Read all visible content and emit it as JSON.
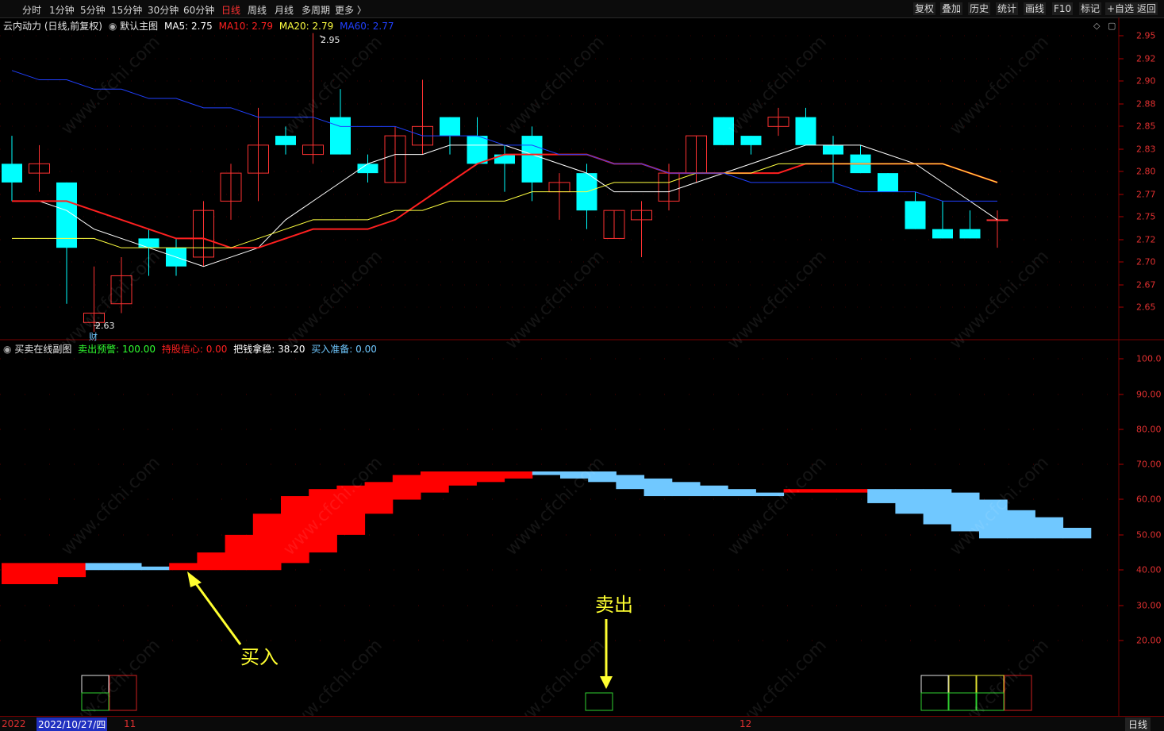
{
  "toolbar": {
    "periods": [
      "分时",
      "1分钟",
      "5分钟",
      "15分钟",
      "30分钟",
      "60分钟",
      "日线",
      "周线",
      "月线",
      "多周期",
      "更多 〉"
    ],
    "active_period": "日线",
    "right_buttons": [
      "复权",
      "叠加",
      "历史",
      "统计",
      "画线",
      "F10",
      "标记",
      "+自选",
      "返回"
    ]
  },
  "main_chart": {
    "stock_title": "云内动力 (日线,前复权)",
    "template": "默认主图",
    "ma": [
      {
        "label": "MA5: 2.75",
        "color": "#ffffff"
      },
      {
        "label": "MA10: 2.79",
        "color": "#ff2020"
      },
      {
        "label": "MA20: 2.79",
        "color": "#ffff40"
      },
      {
        "label": "MA60: 2.77",
        "color": "#2040ff"
      }
    ],
    "high_marker": "2.95",
    "low_marker": "2.63",
    "cai_marker": "财",
    "y_axis": [
      "2.95",
      "2.92",
      "2.90",
      "2.88",
      "2.85",
      "2.83",
      "2.80",
      "2.77",
      "2.75",
      "2.72",
      "2.70",
      "2.67",
      "2.65"
    ]
  },
  "sub_chart": {
    "title": "买卖在线副图",
    "labels": [
      {
        "text": "卖出预警: 100.00",
        "color": "#30ff30"
      },
      {
        "text": "持股信心: 0.00",
        "color": "#ff2020"
      },
      {
        "text": "把钱拿稳: 38.20",
        "color": "#ffffff"
      },
      {
        "text": "买入准备: 0.00",
        "color": "#70c8ff"
      }
    ],
    "y_axis": [
      "100.0",
      "90.00",
      "80.00",
      "70.00",
      "60.00",
      "50.00",
      "40.00",
      "30.00",
      "20.00"
    ],
    "buy_annotation": "买入",
    "sell_annotation": "卖出"
  },
  "bottom_bar": {
    "year": "2022",
    "current_date": "2022/10/27/四",
    "month_11": "11",
    "month_12": "12",
    "period": "日线"
  },
  "watermark": "www.cfchi.com",
  "chart_data": {
    "type": "candlestick",
    "ylim": [
      2.63,
      2.96
    ],
    "candles": [
      {
        "o": 2.81,
        "h": 2.84,
        "l": 2.77,
        "c": 2.79
      },
      {
        "o": 2.8,
        "h": 2.83,
        "l": 2.78,
        "c": 2.81
      },
      {
        "o": 2.79,
        "h": 2.79,
        "l": 2.66,
        "c": 2.72
      },
      {
        "o": 2.64,
        "h": 2.7,
        "l": 2.63,
        "c": 2.65
      },
      {
        "o": 2.66,
        "h": 2.71,
        "l": 2.65,
        "c": 2.69
      },
      {
        "o": 2.73,
        "h": 2.74,
        "l": 2.69,
        "c": 2.72
      },
      {
        "o": 2.72,
        "h": 2.73,
        "l": 2.69,
        "c": 2.7
      },
      {
        "o": 2.71,
        "h": 2.77,
        "l": 2.7,
        "c": 2.76
      },
      {
        "o": 2.77,
        "h": 2.81,
        "l": 2.75,
        "c": 2.8
      },
      {
        "o": 2.8,
        "h": 2.87,
        "l": 2.77,
        "c": 2.83
      },
      {
        "o": 2.84,
        "h": 2.85,
        "l": 2.82,
        "c": 2.83
      },
      {
        "o": 2.82,
        "h": 2.95,
        "l": 2.81,
        "c": 2.83
      },
      {
        "o": 2.86,
        "h": 2.89,
        "l": 2.82,
        "c": 2.82
      },
      {
        "o": 2.81,
        "h": 2.82,
        "l": 2.79,
        "c": 2.8
      },
      {
        "o": 2.79,
        "h": 2.85,
        "l": 2.79,
        "c": 2.84
      },
      {
        "o": 2.83,
        "h": 2.9,
        "l": 2.82,
        "c": 2.85
      },
      {
        "o": 2.86,
        "h": 2.86,
        "l": 2.82,
        "c": 2.84
      },
      {
        "o": 2.84,
        "h": 2.86,
        "l": 2.81,
        "c": 2.81
      },
      {
        "o": 2.82,
        "h": 2.83,
        "l": 2.78,
        "c": 2.81
      },
      {
        "o": 2.84,
        "h": 2.85,
        "l": 2.77,
        "c": 2.79
      },
      {
        "o": 2.78,
        "h": 2.8,
        "l": 2.75,
        "c": 2.79
      },
      {
        "o": 2.8,
        "h": 2.81,
        "l": 2.74,
        "c": 2.76
      },
      {
        "o": 2.73,
        "h": 2.76,
        "l": 2.73,
        "c": 2.76
      },
      {
        "o": 2.75,
        "h": 2.77,
        "l": 2.71,
        "c": 2.76
      },
      {
        "o": 2.77,
        "h": 2.81,
        "l": 2.76,
        "c": 2.8
      },
      {
        "o": 2.8,
        "h": 2.84,
        "l": 2.79,
        "c": 2.84
      },
      {
        "o": 2.86,
        "h": 2.86,
        "l": 2.83,
        "c": 2.83
      },
      {
        "o": 2.84,
        "h": 2.84,
        "l": 2.82,
        "c": 2.83
      },
      {
        "o": 2.85,
        "h": 2.87,
        "l": 2.84,
        "c": 2.86
      },
      {
        "o": 2.86,
        "h": 2.87,
        "l": 2.83,
        "c": 2.83
      },
      {
        "o": 2.83,
        "h": 2.84,
        "l": 2.79,
        "c": 2.82
      },
      {
        "o": 2.82,
        "h": 2.83,
        "l": 2.8,
        "c": 2.8
      },
      {
        "o": 2.8,
        "h": 2.8,
        "l": 2.78,
        "c": 2.78
      },
      {
        "o": 2.77,
        "h": 2.78,
        "l": 2.74,
        "c": 2.74
      },
      {
        "o": 2.74,
        "h": 2.77,
        "l": 2.73,
        "c": 2.73
      },
      {
        "o": 2.74,
        "h": 2.76,
        "l": 2.73,
        "c": 2.73
      },
      {
        "o": 2.75,
        "h": 2.76,
        "l": 2.72,
        "c": 2.75
      }
    ],
    "ma_series": [
      {
        "name": "MA5",
        "color": "#ffffff",
        "values": [
          2.77,
          2.77,
          2.76,
          2.74,
          2.73,
          2.72,
          2.71,
          2.7,
          2.71,
          2.72,
          2.75,
          2.77,
          2.79,
          2.81,
          2.82,
          2.82,
          2.83,
          2.83,
          2.83,
          2.82,
          2.81,
          2.8,
          2.78,
          2.78,
          2.78,
          2.79,
          2.8,
          2.81,
          2.82,
          2.83,
          2.83,
          2.83,
          2.82,
          2.81,
          2.79,
          2.77,
          2.75
        ]
      },
      {
        "name": "MA10",
        "color": "#ff2020",
        "values": [
          2.77,
          2.77,
          2.77,
          2.76,
          2.75,
          2.74,
          2.73,
          2.73,
          2.72,
          2.72,
          2.73,
          2.74,
          2.74,
          2.74,
          2.75,
          2.77,
          2.79,
          2.81,
          2.82,
          2.82,
          2.82,
          2.82,
          2.81,
          2.81,
          2.8,
          2.8,
          2.8,
          2.8,
          2.8,
          2.81,
          2.81,
          2.81,
          2.81,
          2.81,
          2.81,
          2.8,
          2.79
        ]
      },
      {
        "name": "MA20",
        "color": "#ffff40",
        "values": [
          2.73,
          2.73,
          2.73,
          2.73,
          2.72,
          2.72,
          2.72,
          2.72,
          2.72,
          2.73,
          2.74,
          2.75,
          2.75,
          2.75,
          2.76,
          2.76,
          2.77,
          2.77,
          2.77,
          2.78,
          2.78,
          2.78,
          2.79,
          2.79,
          2.79,
          2.8,
          2.8,
          2.8,
          2.81,
          2.81,
          2.81,
          2.81,
          2.81,
          2.81,
          2.81,
          2.8,
          2.79
        ]
      },
      {
        "name": "MA60",
        "color": "#2040ff",
        "values": [
          2.91,
          2.9,
          2.9,
          2.89,
          2.89,
          2.88,
          2.88,
          2.87,
          2.87,
          2.86,
          2.86,
          2.86,
          2.85,
          2.85,
          2.85,
          2.84,
          2.84,
          2.84,
          2.83,
          2.83,
          2.82,
          2.82,
          2.81,
          2.81,
          2.8,
          2.8,
          2.8,
          2.79,
          2.79,
          2.79,
          2.79,
          2.78,
          2.78,
          2.78,
          2.77,
          2.77,
          2.77
        ]
      }
    ],
    "sub_ylim": [
      0,
      100
    ],
    "sub_bars": [
      {
        "lo": 36,
        "hi": 42,
        "t": "r"
      },
      {
        "lo": 36,
        "hi": 42,
        "t": "r"
      },
      {
        "lo": 38,
        "hi": 42,
        "t": "r"
      },
      {
        "lo": 40,
        "hi": 42,
        "t": "b"
      },
      {
        "lo": 40,
        "hi": 42,
        "t": "b"
      },
      {
        "lo": 40,
        "hi": 41,
        "t": "b"
      },
      {
        "lo": 40,
        "hi": 42,
        "t": "r"
      },
      {
        "lo": 40,
        "hi": 45,
        "t": "r"
      },
      {
        "lo": 40,
        "hi": 50,
        "t": "r"
      },
      {
        "lo": 40,
        "hi": 56,
        "t": "r"
      },
      {
        "lo": 42,
        "hi": 61,
        "t": "r"
      },
      {
        "lo": 45,
        "hi": 63,
        "t": "r"
      },
      {
        "lo": 50,
        "hi": 64,
        "t": "r"
      },
      {
        "lo": 56,
        "hi": 65,
        "t": "r"
      },
      {
        "lo": 60,
        "hi": 67,
        "t": "r"
      },
      {
        "lo": 62,
        "hi": 68,
        "t": "r"
      },
      {
        "lo": 64,
        "hi": 68,
        "t": "r"
      },
      {
        "lo": 65,
        "hi": 68,
        "t": "r"
      },
      {
        "lo": 66,
        "hi": 68,
        "t": "r"
      },
      {
        "lo": 67,
        "hi": 68,
        "t": "b"
      },
      {
        "lo": 66,
        "hi": 68,
        "t": "b"
      },
      {
        "lo": 65,
        "hi": 68,
        "t": "b"
      },
      {
        "lo": 63,
        "hi": 67,
        "t": "b"
      },
      {
        "lo": 61,
        "hi": 66,
        "t": "b"
      },
      {
        "lo": 61,
        "hi": 65,
        "t": "b"
      },
      {
        "lo": 61,
        "hi": 64,
        "t": "b"
      },
      {
        "lo": 61,
        "hi": 63,
        "t": "b"
      },
      {
        "lo": 61,
        "hi": 62,
        "t": "b"
      },
      {
        "lo": 62,
        "hi": 63,
        "t": "r"
      },
      {
        "lo": 62,
        "hi": 63,
        "t": "r"
      },
      {
        "lo": 62,
        "hi": 63,
        "t": "r"
      },
      {
        "lo": 59,
        "hi": 63,
        "t": "b"
      },
      {
        "lo": 56,
        "hi": 63,
        "t": "b"
      },
      {
        "lo": 53,
        "hi": 63,
        "t": "b"
      },
      {
        "lo": 51,
        "hi": 62,
        "t": "b"
      },
      {
        "lo": 49,
        "hi": 60,
        "t": "b"
      },
      {
        "lo": 49,
        "hi": 57,
        "t": "b"
      },
      {
        "lo": 49,
        "hi": 55,
        "t": "b"
      },
      {
        "lo": 49,
        "hi": 52,
        "t": "b"
      }
    ],
    "signal_boxes": [
      {
        "idx": 3,
        "type": "green-white"
      },
      {
        "idx": 4,
        "type": "red"
      },
      {
        "idx": 21,
        "type": "green"
      },
      {
        "idx": 33,
        "type": "green-white"
      },
      {
        "idx": 34,
        "type": "green-yellow"
      },
      {
        "idx": 35,
        "type": "green-yellow"
      },
      {
        "idx": 36,
        "type": "red"
      }
    ]
  }
}
